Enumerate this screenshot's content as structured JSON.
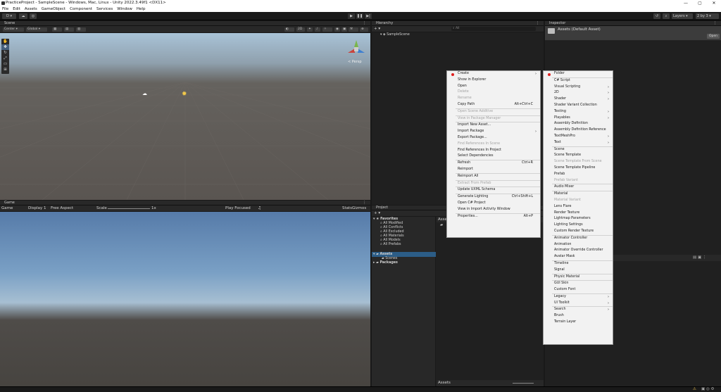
{
  "window": {
    "title": "PracticeProject - SampleScene - Windows, Mac, Linux - Unity 2022.3.49f1 <DX11>",
    "minimize": "—",
    "maximize": "▢",
    "close": "✕"
  },
  "menubar": [
    "File",
    "Edit",
    "Assets",
    "GameObject",
    "Component",
    "Services",
    "Window",
    "Help"
  ],
  "toolbar": {
    "account": "D ▾",
    "layers": "Layers",
    "layout": "2 by 3",
    "play": "▶",
    "pause": "❚❚",
    "step": "▶|"
  },
  "scene": {
    "tab": "Scene",
    "center": "Center ▾",
    "global": "Global ▾",
    "scale": "2D",
    "persp": "< Persp"
  },
  "game": {
    "tab": "Game",
    "display_mode": "Game",
    "display": "Display 1",
    "aspect": "Free Aspect",
    "scale_label": "Scale",
    "scale_value": "1x",
    "play_focused": "Play Focused",
    "stats": "Stats",
    "gizmos": "Gizmos"
  },
  "hierarchy": {
    "tab": "Hierarchy",
    "add": "+ ▾",
    "search_placeholder": "All",
    "scene": "SampleScene"
  },
  "inspector": {
    "tab": "Inspector",
    "asset_title": "Assets (Default Asset)",
    "open": "Open"
  },
  "project": {
    "tab": "Project",
    "add": "+ ▾",
    "favorites": "Favorites",
    "favorite_items": [
      "All Modified",
      "All Conflicts",
      "All Excluded",
      "All Materials",
      "All Models",
      "All Prefabs"
    ],
    "assets": "Assets",
    "scenes": "Scenes",
    "packages": "Packages",
    "breadcrumb": "Assets",
    "footer": "Assets"
  },
  "context_menu": [
    {
      "label": "Create",
      "dot": true,
      "arrow": true
    },
    {
      "label": "Show in Explorer"
    },
    {
      "label": "Open"
    },
    {
      "label": "Delete",
      "disabled": true
    },
    {
      "label": "Rename",
      "disabled": true
    },
    {
      "label": "Copy Path",
      "shortcut": "Alt+Ctrl+C"
    },
    {
      "sep": true
    },
    {
      "label": "Open Scene Additive",
      "disabled": true
    },
    {
      "sep": true
    },
    {
      "label": "View in Package Manager",
      "disabled": true
    },
    {
      "sep": true
    },
    {
      "label": "Import New Asset..."
    },
    {
      "label": "Import Package",
      "arrow": true
    },
    {
      "label": "Export Package..."
    },
    {
      "label": "Find References In Scene",
      "disabled": true
    },
    {
      "label": "Find References In Project"
    },
    {
      "label": "Select Dependencies"
    },
    {
      "sep": true
    },
    {
      "label": "Refresh",
      "shortcut": "Ctrl+R"
    },
    {
      "label": "Reimport"
    },
    {
      "sep": true
    },
    {
      "label": "Reimport All"
    },
    {
      "sep": true
    },
    {
      "label": "Extract From Prefab",
      "disabled": true
    },
    {
      "sep": true
    },
    {
      "label": "Update UXML Schema"
    },
    {
      "sep": true
    },
    {
      "label": "Generate Lighting",
      "shortcut": "Ctrl+Shift+L"
    },
    {
      "label": "Open C# Project"
    },
    {
      "label": "View in Import Activity Window"
    },
    {
      "sep": true
    },
    {
      "label": "Properties...",
      "shortcut": "Alt+P"
    }
  ],
  "create_menu": [
    {
      "label": "Folder",
      "dot": true
    },
    {
      "sep": true
    },
    {
      "label": "C# Script"
    },
    {
      "label": "Visual Scripting",
      "arrow": true
    },
    {
      "label": "2D",
      "arrow": true
    },
    {
      "label": "Shader",
      "arrow": true
    },
    {
      "label": "Shader Variant Collection"
    },
    {
      "label": "Testing",
      "arrow": true
    },
    {
      "label": "Playables",
      "arrow": true
    },
    {
      "label": "Assembly Definition"
    },
    {
      "label": "Assembly Definition Reference"
    },
    {
      "label": "TextMeshPro",
      "arrow": true
    },
    {
      "label": "Text",
      "arrow": true
    },
    {
      "sep": true
    },
    {
      "label": "Scene"
    },
    {
      "label": "Scene Template"
    },
    {
      "label": "Scene Template From Scene",
      "disabled": true
    },
    {
      "label": "Scene Template Pipeline"
    },
    {
      "label": "Prefab"
    },
    {
      "label": "Prefab Variant",
      "disabled": true
    },
    {
      "sep": true
    },
    {
      "label": "Audio Mixer"
    },
    {
      "sep": true
    },
    {
      "label": "Material"
    },
    {
      "label": "Material Variant",
      "disabled": true
    },
    {
      "label": "Lens Flare"
    },
    {
      "label": "Render Texture"
    },
    {
      "label": "Lightmap Parameters"
    },
    {
      "label": "Lighting Settings"
    },
    {
      "label": "Custom Render Texture"
    },
    {
      "sep": true
    },
    {
      "label": "Animator Controller"
    },
    {
      "label": "Animation"
    },
    {
      "label": "Animator Override Controller"
    },
    {
      "label": "Avatar Mask"
    },
    {
      "sep": true
    },
    {
      "label": "Timeline"
    },
    {
      "label": "Signal"
    },
    {
      "sep": true
    },
    {
      "label": "Physic Material"
    },
    {
      "sep": true
    },
    {
      "label": "GUI Skin"
    },
    {
      "label": "Custom Font"
    },
    {
      "sep": true
    },
    {
      "label": "Legacy",
      "arrow": true
    },
    {
      "label": "UI Toolkit",
      "arrow": true
    },
    {
      "sep": true
    },
    {
      "label": "Search",
      "arrow": true
    },
    {
      "label": "Brush"
    },
    {
      "label": "Terrain Layer"
    }
  ]
}
